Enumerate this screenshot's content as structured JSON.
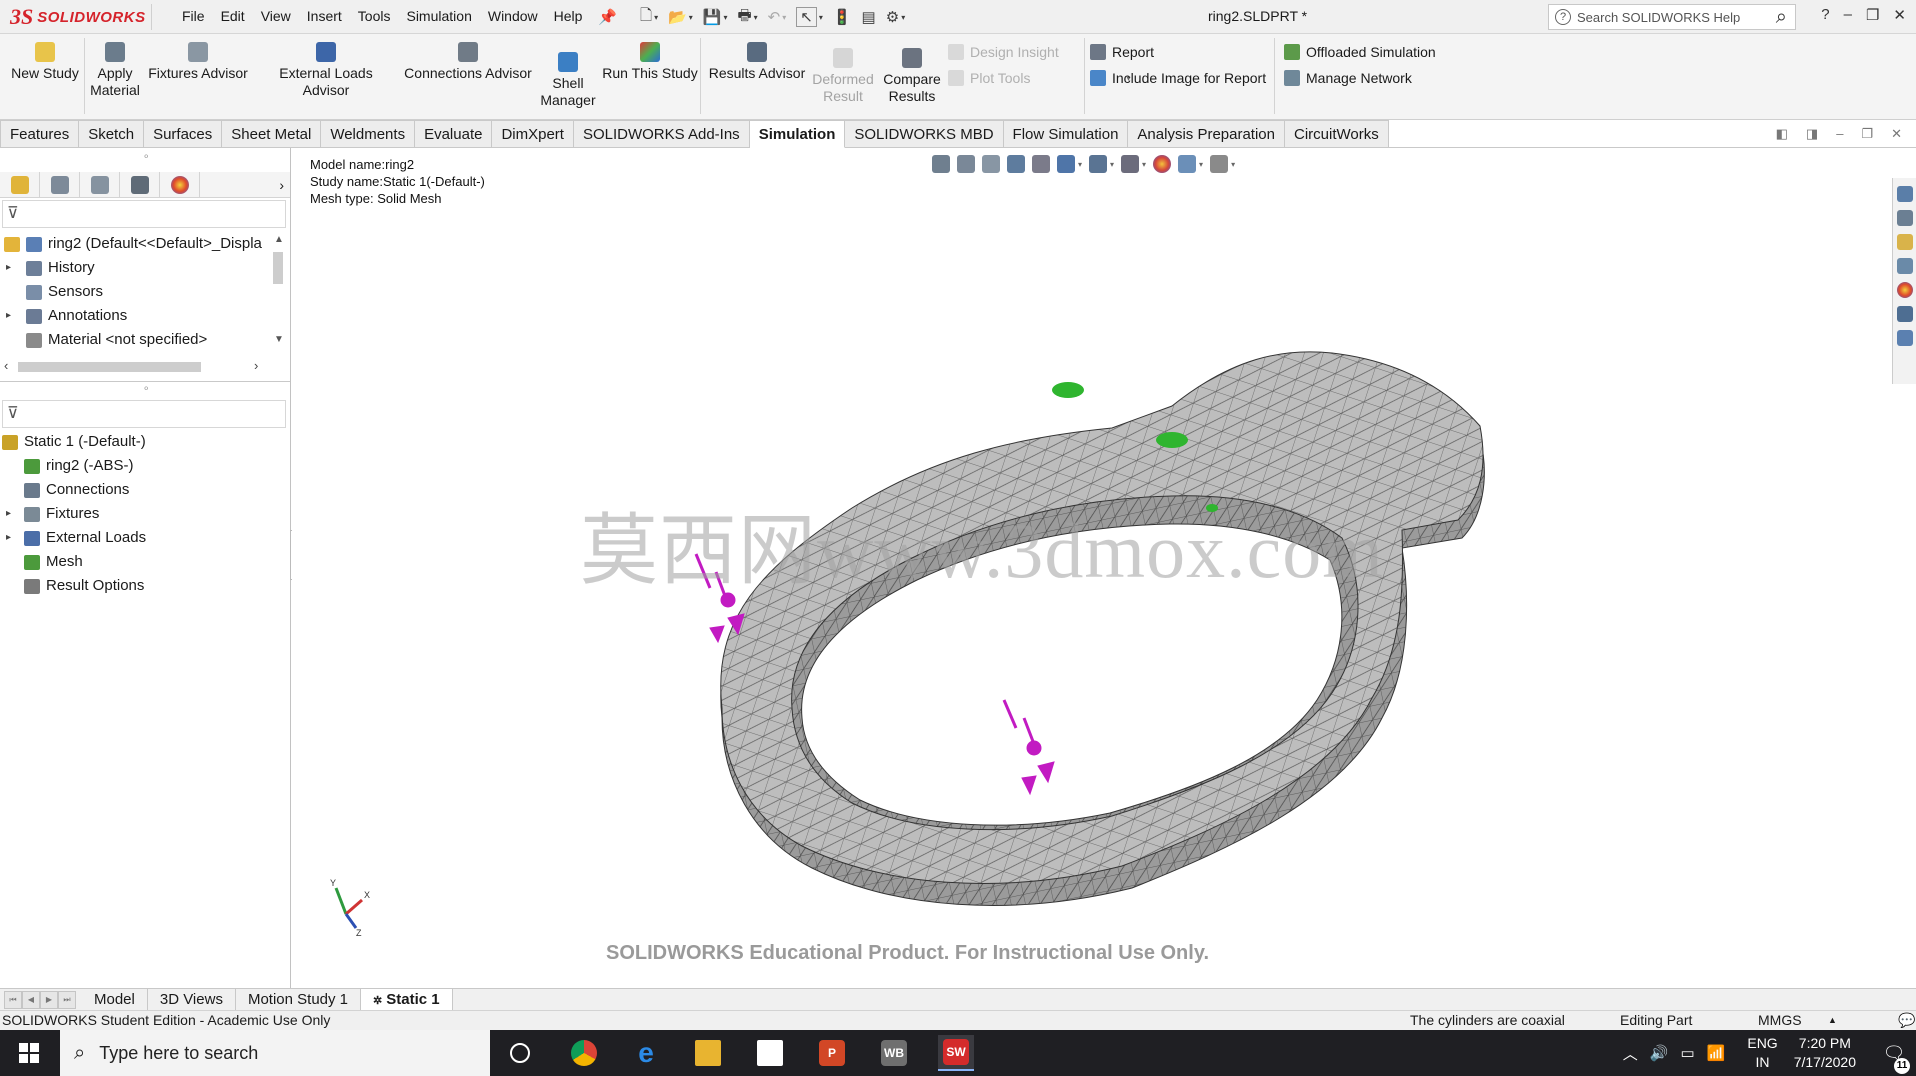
{
  "app": {
    "logo_mark": "3S",
    "logo_word": "SOLIDWORKS",
    "document_title": "ring2.SLDPRT *",
    "menus": [
      "File",
      "Edit",
      "View",
      "Insert",
      "Tools",
      "Simulation",
      "Window",
      "Help"
    ],
    "help_search_placeholder": "Search SOLIDWORKS Help",
    "help_q": "?",
    "help_button": "?",
    "window_controls": [
      "–",
      "❐",
      "✕"
    ]
  },
  "command_manager": {
    "new_study": "New Study",
    "apply_material": "Apply\nMaterial",
    "apply_material_l1": "Apply",
    "apply_material_l2": "Material",
    "fixtures_advisor": "Fixtures Advisor",
    "external_loads_advisor": "External Loads Advisor",
    "connections_advisor": "Connections Advisor",
    "shell_manager_l1": "Shell",
    "shell_manager_l2": "Manager",
    "run_this_study": "Run This Study",
    "results_advisor": "Results Advisor",
    "deformed_result_l1": "Deformed",
    "deformed_result_l2": "Result",
    "compare_results_l1": "Compare",
    "compare_results_l2": "Results",
    "design_insight": "Design Insight",
    "plot_tools": "Plot Tools",
    "report": "Report",
    "include_image": "Include Image for Report",
    "offloaded_simulation": "Offloaded Simulation",
    "manage_network": "Manage Network"
  },
  "tabs": [
    {
      "label": "Features",
      "active": false
    },
    {
      "label": "Sketch",
      "active": false
    },
    {
      "label": "Surfaces",
      "active": false
    },
    {
      "label": "Sheet Metal",
      "active": false
    },
    {
      "label": "Weldments",
      "active": false
    },
    {
      "label": "Evaluate",
      "active": false
    },
    {
      "label": "DimXpert",
      "active": false
    },
    {
      "label": "SOLIDWORKS Add-Ins",
      "active": false
    },
    {
      "label": "Simulation",
      "active": true
    },
    {
      "label": "SOLIDWORKS MBD",
      "active": false
    },
    {
      "label": "Flow Simulation",
      "active": false
    },
    {
      "label": "Analysis Preparation",
      "active": false
    },
    {
      "label": "CircuitWorks",
      "active": false
    }
  ],
  "feature_tree": {
    "items": [
      {
        "label": "ring2  (Default<<Default>_Displa",
        "arrow": "",
        "icon": "part-icon",
        "color": "#5a7fb5"
      },
      {
        "label": "History",
        "arrow": "▸",
        "icon": "history-icon",
        "color": "#6d7f99"
      },
      {
        "label": "Sensors",
        "arrow": "",
        "icon": "sensors-icon",
        "color": "#7a8ea8"
      },
      {
        "label": "Annotations",
        "arrow": "▸",
        "icon": "annotations-icon",
        "color": "#6b7b95"
      },
      {
        "label": "Material <not specified>",
        "arrow": "",
        "icon": "material-icon",
        "color": "#8a8a8a"
      }
    ]
  },
  "simulation_tree": {
    "items": [
      {
        "label": "Static 1 (-Default-)",
        "arrow": "",
        "icon": "static-study-icon",
        "color": "#c9a227"
      },
      {
        "label": "ring2 (-ABS-)",
        "arrow": "",
        "icon": "part-material-icon",
        "color": "#4c9a3c"
      },
      {
        "label": "Connections",
        "arrow": "",
        "icon": "connections-icon",
        "color": "#6a7a8c"
      },
      {
        "label": "Fixtures",
        "arrow": "▸",
        "icon": "fixtures-icon",
        "color": "#7b8a96"
      },
      {
        "label": "External Loads",
        "arrow": "▸",
        "icon": "external-loads-icon",
        "color": "#4b6ea8"
      },
      {
        "label": "Mesh",
        "arrow": "",
        "icon": "mesh-icon",
        "color": "#4c9a3c"
      },
      {
        "label": "Result Options",
        "arrow": "",
        "icon": "result-options-icon",
        "color": "#7a7a7a"
      }
    ]
  },
  "graphics": {
    "model_name": "Model name:ring2",
    "study_name": "Study name:Static 1(-Default-)",
    "mesh_type": "Mesh type: Solid Mesh",
    "watermark": "莫西网www.3dmox.com",
    "edu_notice": "SOLIDWORKS Educational Product. For Instructional Use Only.",
    "triad_labels": [
      "Y",
      "X",
      "Z"
    ],
    "mesh_color": "#b9b9b9",
    "fixture_color": "#2fb52f",
    "load_color": "#c21bc2"
  },
  "bottom_tabs": [
    {
      "label": "Model",
      "active": false
    },
    {
      "label": "3D Views",
      "active": false
    },
    {
      "label": "Motion Study 1",
      "active": false
    },
    {
      "label": "Static 1",
      "active": true
    }
  ],
  "status_bar": {
    "left": "SOLIDWORKS Student Edition - Academic Use Only",
    "message": "The cylinders are coaxial",
    "mode": "Editing Part",
    "units": "MMGS"
  },
  "taskbar": {
    "search_placeholder": "Type here to search",
    "apps": [
      "task-view",
      "chrome",
      "edge",
      "file-explorer",
      "store",
      "powerpoint",
      "workbench",
      "solidworks"
    ],
    "wb_label": "WB",
    "sw_label": "SW",
    "lang_l1": "ENG",
    "lang_l2": "IN",
    "time": "7:20 PM",
    "date": "7/17/2020",
    "notifications": "11"
  }
}
